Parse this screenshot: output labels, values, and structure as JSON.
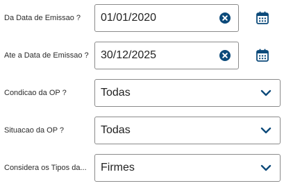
{
  "colors": {
    "accent": "#0c4a7a",
    "border": "#8a8a8a",
    "text": "#222222"
  },
  "fields": {
    "data_inicio": {
      "label": "Da Data de Emissao ?",
      "value": "01/01/2020",
      "clear_icon": "clear-circle-icon",
      "picker_icon": "calendar-icon"
    },
    "data_fim": {
      "label": "Ate a Data de Emissao ?",
      "value": "30/12/2025",
      "clear_icon": "clear-circle-icon",
      "picker_icon": "calendar-icon"
    },
    "condicao_op": {
      "label": "Condicao da OP ?",
      "selected": "Todas",
      "icon": "chevron-down-icon"
    },
    "situacao_op": {
      "label": "Situacao da OP ?",
      "selected": "Todas",
      "icon": "chevron-down-icon"
    },
    "tipos": {
      "label": "Considera os Tipos da...",
      "selected": "Firmes",
      "icon": "chevron-down-icon"
    }
  }
}
